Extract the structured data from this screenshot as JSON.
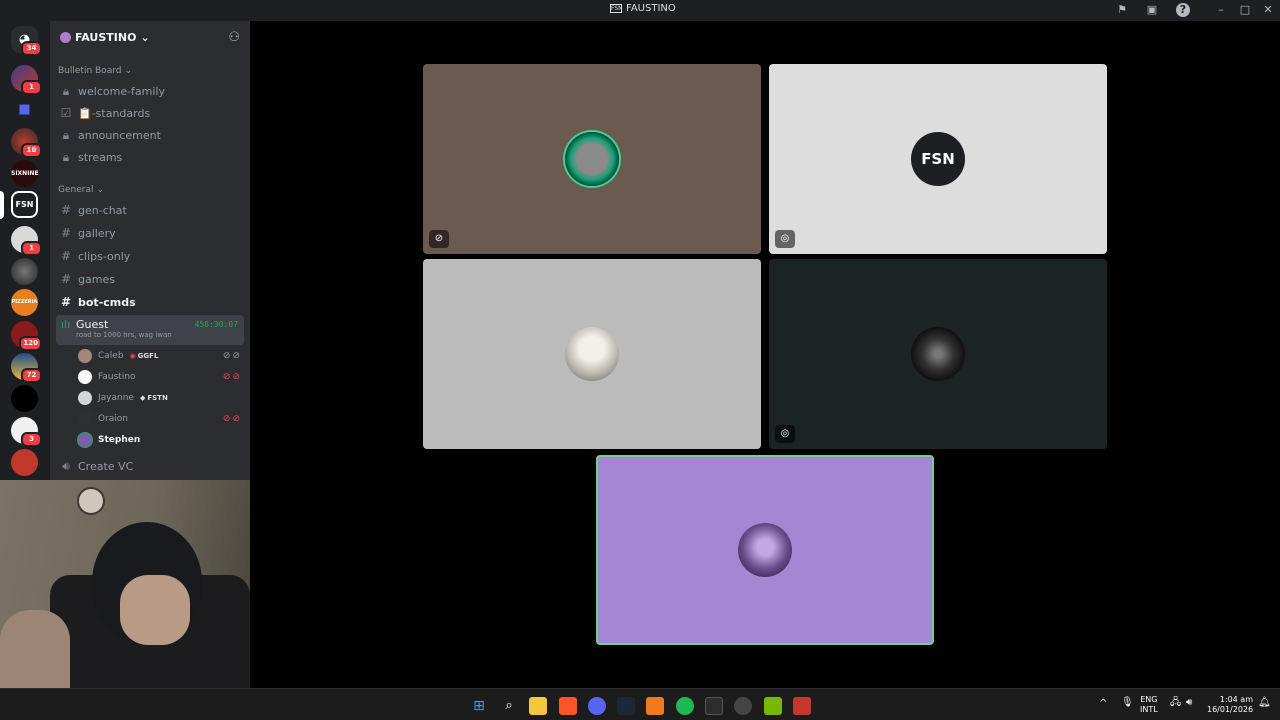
{
  "window": {
    "title": "FAUSTINO",
    "title_logo": "FSN"
  },
  "titlebar_icons": [
    "inbox-flag-icon",
    "window-icon",
    "help-icon"
  ],
  "window_controls": [
    "minimize-icon",
    "maximize-icon",
    "close-icon"
  ],
  "servers": [
    {
      "name": "home",
      "badge": "34"
    },
    {
      "name": "server-1",
      "badge": "1"
    },
    {
      "name": "folder",
      "badge": ""
    },
    {
      "name": "server-3",
      "badge": "10"
    },
    {
      "name": "sixnine",
      "label": "SIXNINE",
      "badge": ""
    },
    {
      "name": "fsn",
      "label": "FSN",
      "badge": ""
    },
    {
      "name": "server-6",
      "badge": "1"
    },
    {
      "name": "server-7",
      "badge": ""
    },
    {
      "name": "pizzeria",
      "label": "PIZZERIA",
      "badge": ""
    },
    {
      "name": "server-9",
      "badge": "120"
    },
    {
      "name": "server-10",
      "badge": "72"
    },
    {
      "name": "server-11",
      "badge": ""
    },
    {
      "name": "server-12",
      "badge": "3"
    },
    {
      "name": "server-13",
      "badge": ""
    }
  ],
  "guild": {
    "name": "FAUSTINO"
  },
  "categories": {
    "bulletin": {
      "label": "Bulletin Board"
    },
    "general": {
      "label": "General"
    }
  },
  "bulletin_channels": [
    {
      "name": "welcome-family",
      "icon": "lock-icon"
    },
    {
      "name": "📋-standards",
      "icon": "checkbox-icon"
    },
    {
      "name": "announcement",
      "icon": "lock-icon"
    },
    {
      "name": "streams",
      "icon": "lock-icon"
    }
  ],
  "general_channels": [
    {
      "name": "gen-chat"
    },
    {
      "name": "gallery"
    },
    {
      "name": "clips-only"
    },
    {
      "name": "games"
    },
    {
      "name": "bot-cmds"
    }
  ],
  "voice_channel": {
    "name": "Guest",
    "status": "road to 1000 hrs, wag iwan",
    "timer": "458:30:07",
    "users": [
      {
        "name": "Caleb",
        "tag": "GGFL",
        "icons": "muted-deafened"
      },
      {
        "name": "Faustino",
        "tag": "",
        "icons": "muted-deafened-red"
      },
      {
        "name": "Jayanne",
        "tag": "FSTN",
        "icons": ""
      },
      {
        "name": "Oraion",
        "tag": "",
        "icons": "muted-deafened-red"
      },
      {
        "name": "Stephen",
        "tag": "",
        "icons": ""
      }
    ]
  },
  "create_vc": {
    "label": "Create VC"
  },
  "tiles": [
    {
      "name": "tile-1",
      "bg": "#6b5a4f",
      "corner": "muted-icon"
    },
    {
      "name": "tile-2",
      "bg": "#dddddd",
      "corner": "deafened-icon"
    },
    {
      "name": "tile-3",
      "bg": "#bbbbbb",
      "corner": ""
    },
    {
      "name": "tile-4",
      "bg": "#1b2323",
      "corner": "deafened-icon"
    },
    {
      "name": "tile-5",
      "bg": "#a586d3",
      "corner": ""
    }
  ],
  "taskbar": {
    "apps": [
      "start-icon",
      "search-icon",
      "file-explorer-icon",
      "brave-icon",
      "discord-icon",
      "steam-icon",
      "app-icon",
      "spotify-icon",
      "terminal-icon",
      "chrome-icon",
      "nvidia-icon",
      "app-x-icon"
    ],
    "lang_top": "ENG",
    "lang_bottom": "INTL",
    "time": "1:04 am",
    "date": "16/01/2026"
  }
}
